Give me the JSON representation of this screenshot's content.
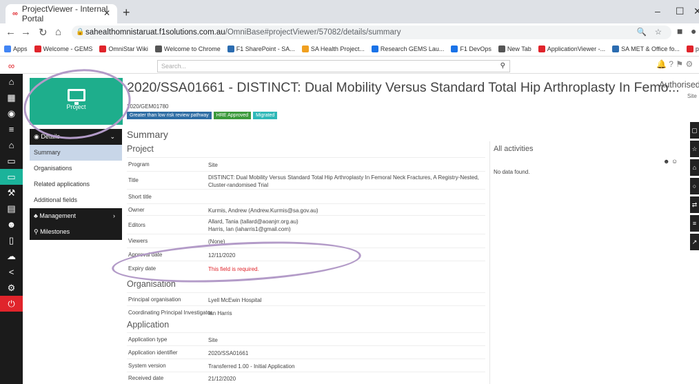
{
  "browser": {
    "tab_title": "ProjectViewer - Internal Portal",
    "url_host": "sahealthomnistaruat.f1solutions.com.au",
    "url_path": "/OmniBase#projectViewer/57082/details/summary"
  },
  "bookmarks": [
    {
      "label": "Apps",
      "color": "#4285f4"
    },
    {
      "label": "Welcome - GEMS",
      "color": "#e0242b"
    },
    {
      "label": "OmniStar Wiki",
      "color": "#e0242b"
    },
    {
      "label": "Welcome to Chrome",
      "color": "#555555"
    },
    {
      "label": "F1 SharePoint - SA...",
      "color": "#2b6cb0"
    },
    {
      "label": "SA Health Project...",
      "color": "#f0a020"
    },
    {
      "label": "Research GEMS Lau...",
      "color": "#1a73e8"
    },
    {
      "label": "F1 DevOps",
      "color": "#1a73e8"
    },
    {
      "label": "New Tab",
      "color": "#555555"
    },
    {
      "label": "ApplicationViewer -...",
      "color": "#e0242b"
    },
    {
      "label": "SA MET & Office fo...",
      "color": "#2b6cb0"
    },
    {
      "label": "parent",
      "color": "#e0242b"
    }
  ],
  "search": {
    "placeholder": "Search..."
  },
  "project": {
    "tile_label": "Project",
    "title": "2020/SSA01661 - DISTINCT: Dual Mobility Versus Standard Total Hip Arthroplasty In Femo...",
    "code": "2020/GEM01780",
    "status": "Authorised",
    "status_sub": "Site",
    "badges": [
      {
        "label": "Greater than low risk review pathway",
        "color": "#2e6da4"
      },
      {
        "label": "HRE Approved",
        "color": "#3c9a3c"
      },
      {
        "label": "Migrated",
        "color": "#2eb8b8"
      }
    ]
  },
  "menu": {
    "details": "Details",
    "summary": "Summary",
    "organisations": "Organisations",
    "related": "Related applications",
    "additional": "Additional fields",
    "management": "Management",
    "milestones": "Milestones"
  },
  "summary": {
    "heading": "Summary",
    "project_heading": "Project",
    "organisation_heading": "Organisation",
    "application_heading": "Application",
    "project_rows": [
      {
        "label": "Program",
        "value": "Site"
      },
      {
        "label": "Title",
        "value": "DISTINCT: Dual Mobility Versus Standard Total Hip Arthroplasty In Femoral Neck Fractures, A Registry-Nested, Cluster-randomised Trial"
      },
      {
        "label": "Short title",
        "value": ""
      },
      {
        "label": "Owner",
        "value": "Kurmis, Andrew (Andrew.Kurmis@sa.gov.au)"
      },
      {
        "label": "Editors",
        "value": "Allard, Tania (tallard@aoanjrr.org.au)\nHarris, Ian (iaharris1@gmail.com)"
      },
      {
        "label": "Viewers",
        "value": "(None)"
      },
      {
        "label": "Approval date",
        "value": "12/11/2020"
      },
      {
        "label": "Expiry date",
        "value": "This field is required."
      }
    ],
    "organisation_rows": [
      {
        "label": "Principal organisation",
        "value": "Lyell McEwin Hospital"
      },
      {
        "label": "Coordinating Principal Investigator",
        "value": "Ian Harris"
      }
    ],
    "application_rows": [
      {
        "label": "Application type",
        "value": "Site"
      },
      {
        "label": "Application identifier",
        "value": "2020/SSA01661"
      },
      {
        "label": "System version",
        "value": "Transferred 1.00 - Initial Application"
      },
      {
        "label": "Received date",
        "value": "21/12/2020"
      }
    ]
  },
  "activities": {
    "title": "All activities",
    "empty": "No data found."
  }
}
